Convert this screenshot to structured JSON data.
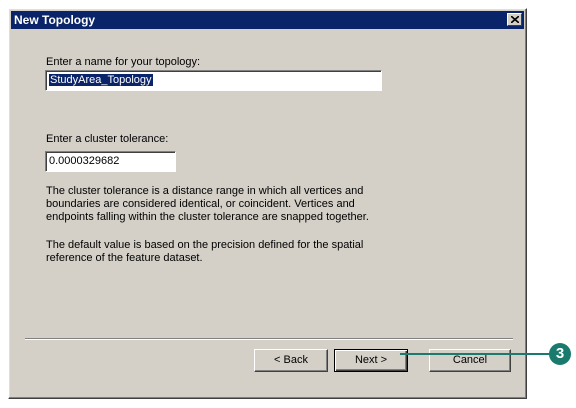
{
  "window": {
    "title": "New Topology"
  },
  "form": {
    "name_label": "Enter a name for your topology:",
    "name_value": "StudyArea_Topology",
    "tolerance_label": "Enter a cluster tolerance:",
    "tolerance_value": "0.0000329682"
  },
  "help": {
    "paragraph1_line1": "The cluster tolerance is a distance range in which all vertices and",
    "paragraph1_line2": "boundaries are considered identical, or coincident. Vertices and",
    "paragraph1_line3": "endpoints falling within the cluster tolerance are snapped together.",
    "paragraph2_line1": "The default value is based on the precision defined for the spatial",
    "paragraph2_line2": "reference of the feature dataset."
  },
  "buttons": {
    "back_label": "< Back",
    "next_label": "Next >",
    "cancel_label": "Cancel"
  },
  "annotation": {
    "step_number": "3",
    "color": "#1a7a6e"
  },
  "colors": {
    "title_bar": "#0a246a",
    "dialog_face": "#d4d0c8"
  }
}
